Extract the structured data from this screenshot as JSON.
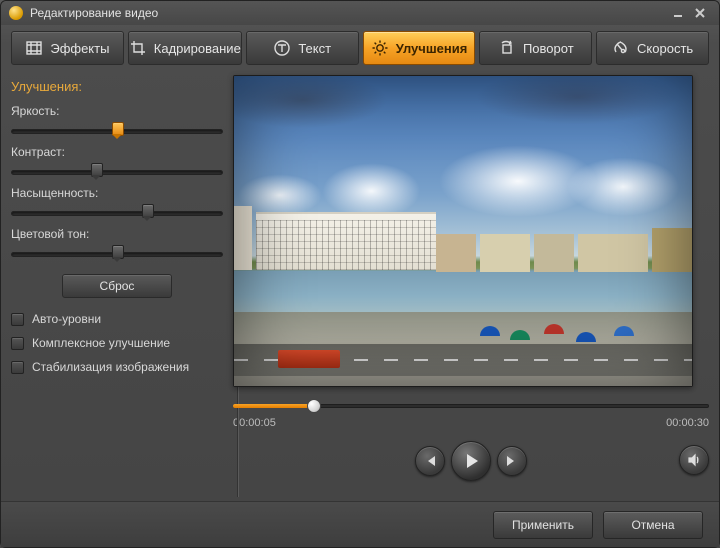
{
  "window": {
    "title": "Редактирование видео"
  },
  "tabs": {
    "effects": {
      "label": "Эффекты"
    },
    "crop": {
      "label": "Кадрирование"
    },
    "text": {
      "label": "Текст"
    },
    "enhance": {
      "label": "Улучшения"
    },
    "rotate": {
      "label": "Поворот"
    },
    "speed": {
      "label": "Скорость"
    },
    "active": "enhance"
  },
  "panel": {
    "title": "Улучшения:",
    "sliders": {
      "brightness": {
        "label": "Яркость:",
        "value": 50
      },
      "contrast": {
        "label": "Контраст:",
        "value": 40
      },
      "saturation": {
        "label": "Насыщенность:",
        "value": 64
      },
      "hue": {
        "label": "Цветовой тон:",
        "value": 50
      }
    },
    "reset_label": "Сброс",
    "checks": {
      "autolevels": {
        "label": "Авто-уровни",
        "checked": false
      },
      "complex": {
        "label": "Комплексное улучшение",
        "checked": false
      },
      "stabilize": {
        "label": "Стабилизация изображения",
        "checked": false
      }
    }
  },
  "player": {
    "position_pct": 17,
    "current_time": "00:00:05",
    "total_time": "00:00:30"
  },
  "footer": {
    "apply": "Применить",
    "cancel": "Отмена"
  }
}
